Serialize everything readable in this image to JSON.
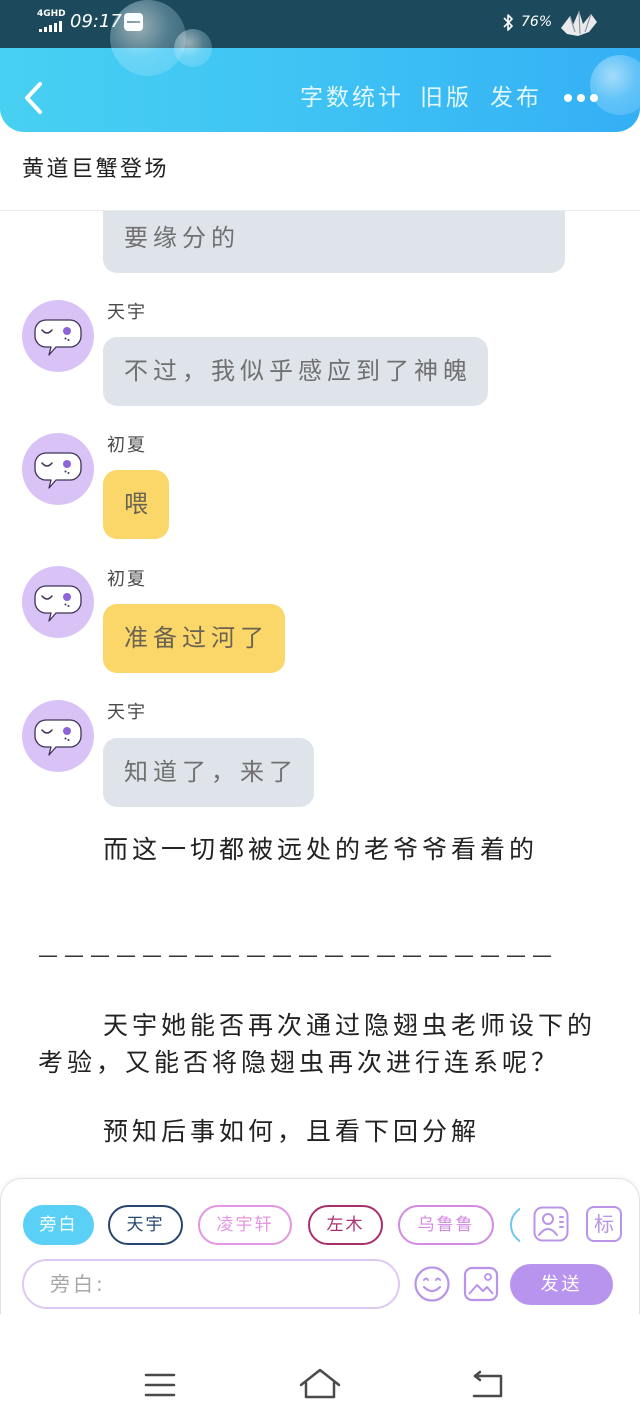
{
  "status_bar": {
    "network": "4GHD",
    "time": "09:17",
    "battery": "76%",
    "icons": [
      "signal-icon",
      "app-notification-icon",
      "bluetooth-icon",
      "brand-logo-icon"
    ]
  },
  "header": {
    "back_icon": "chevron-left-icon",
    "actions": [
      {
        "label": "字数统计"
      },
      {
        "label": "旧版"
      },
      {
        "label": "发布"
      }
    ],
    "more_icon": "more-dots-icon"
  },
  "chapter": {
    "title": "黄道巨蟹登场"
  },
  "messages": [
    {
      "text": "要缘分的",
      "bubble": "gray"
    },
    {
      "speaker": "天宇",
      "text": "不过，我似乎感应到了神魄",
      "bubble": "gray",
      "avatar_icon": "chat-bubble-avatar-icon"
    },
    {
      "speaker": "初夏",
      "text": "喂",
      "bubble": "yellow",
      "avatar_icon": "chat-bubble-avatar-icon"
    },
    {
      "speaker": "初夏",
      "text": "准备过河了",
      "bubble": "yellow",
      "avatar_icon": "chat-bubble-avatar-icon"
    },
    {
      "speaker": "天宇",
      "text": "知道了，来了",
      "bubble": "gray",
      "avatar_icon": "chat-bubble-avatar-icon"
    }
  ],
  "narration": [
    "而这一切都被远处的老爷爷看着的",
    "————————————————————",
    "天宇她能否再次通过隐翅虫老师设下的考验，又能否将隐翅虫再次进行连系呢？",
    "预知后事如何，且看下回分解"
  ],
  "composer": {
    "roles": [
      {
        "label": "旁白",
        "selected": true,
        "color": "#5bd0f6"
      },
      {
        "label": "天宇",
        "selected": false,
        "color": "#27466f"
      },
      {
        "label": "凌宇轩",
        "selected": false,
        "color": "#e396e2"
      },
      {
        "label": "左木",
        "selected": false,
        "color": "#a8306f"
      },
      {
        "label": "乌鲁鲁",
        "selected": false,
        "color": "#d28ae2"
      }
    ],
    "role_manager_icon": "person-card-icon",
    "tag_button_label": "标",
    "input_placeholder": "旁白:",
    "emoji_icon": "smiley-icon",
    "image_icon": "image-icon",
    "send_label": "发送"
  },
  "nav_bar": {
    "icons": [
      "menu-icon",
      "home-icon",
      "back-icon"
    ]
  },
  "colors": {
    "status_bar": "#1c4a5c",
    "header_gradient": [
      "#48d0f2",
      "#34aff5"
    ],
    "accent_purple": "#b994ef",
    "bubbles": {
      "gray": {
        "background": "#dfe4eb",
        "text": "#707070"
      },
      "yellow": {
        "background": "#fbd669",
        "text": "#6b6452"
      }
    }
  }
}
